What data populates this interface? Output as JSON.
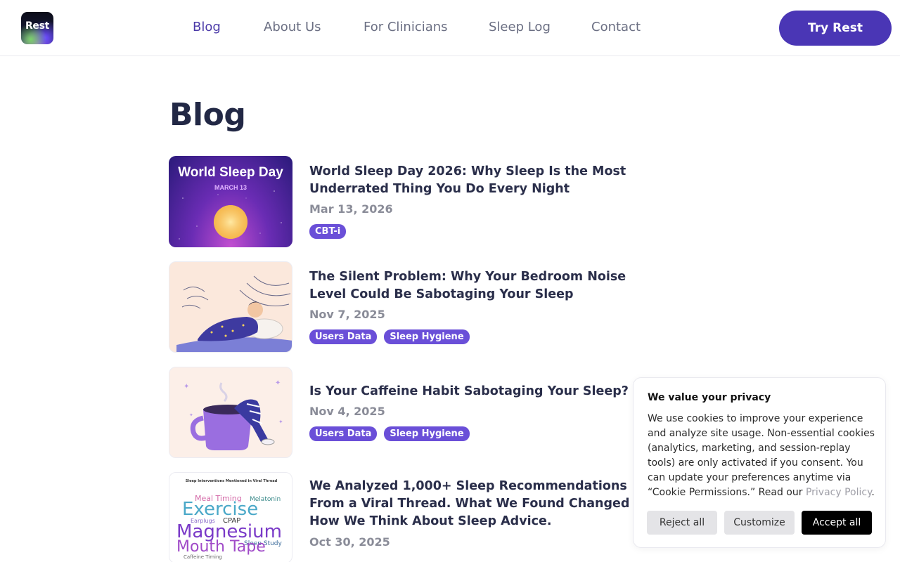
{
  "header": {
    "logo_text": "Rest",
    "nav": [
      "Blog",
      "About Us",
      "For Clinicians",
      "Sleep Log",
      "Contact"
    ],
    "cta_label": "Try Rest"
  },
  "main": {
    "title": "Blog",
    "posts": [
      {
        "title": "World Sleep Day 2026: Why Sleep Is the Most Underrated Thing You Do Every Night",
        "date": "Mar 13, 2026",
        "tags": [
          "CBT-i"
        ],
        "thumb_text": [
          "World Sleep Day",
          "MARCH 13"
        ]
      },
      {
        "title": "The Silent Problem: Why Your Bedroom Noise Level Could Be Sabotaging Your Sleep",
        "date": "Nov 7, 2025",
        "tags": [
          "Users Data",
          "Sleep Hygiene"
        ]
      },
      {
        "title": "Is Your Caffeine Habit Sabotaging Your Sleep?",
        "date": "Nov 4, 2025",
        "tags": [
          "Users Data",
          "Sleep Hygiene"
        ]
      },
      {
        "title": "We Analyzed 1,000+ Sleep Recommendations From a Viral Thread. What We Found Changed How We Think About Sleep Advice.",
        "date": "Oct 30, 2025",
        "tags": [],
        "thumb_text": [
          "Sleep Interventions Mentioned in Viral Thread",
          "Meal Timing",
          "Melatonin",
          "Exercise",
          "Earplugs",
          "CPAP",
          "Magnesium",
          "Sleep Study",
          "Mouth Tape",
          "Caffeine Timing"
        ]
      }
    ]
  },
  "cookie": {
    "title": "We value your privacy",
    "body": "We use cookies to improve your experience and analyze site usage. Non-essential cookies (analytics, marketing, and session-replay tools) are only activated if you consent. You can update your preferences anytime via “Cookie Permissions.” Read our ",
    "link": "Privacy Policy",
    "body_end": ".",
    "reject": "Reject all",
    "customize": "Customize",
    "accept": "Accept all"
  },
  "colors": {
    "brand": "#4a36b5",
    "tag": "#6a4fd8"
  }
}
